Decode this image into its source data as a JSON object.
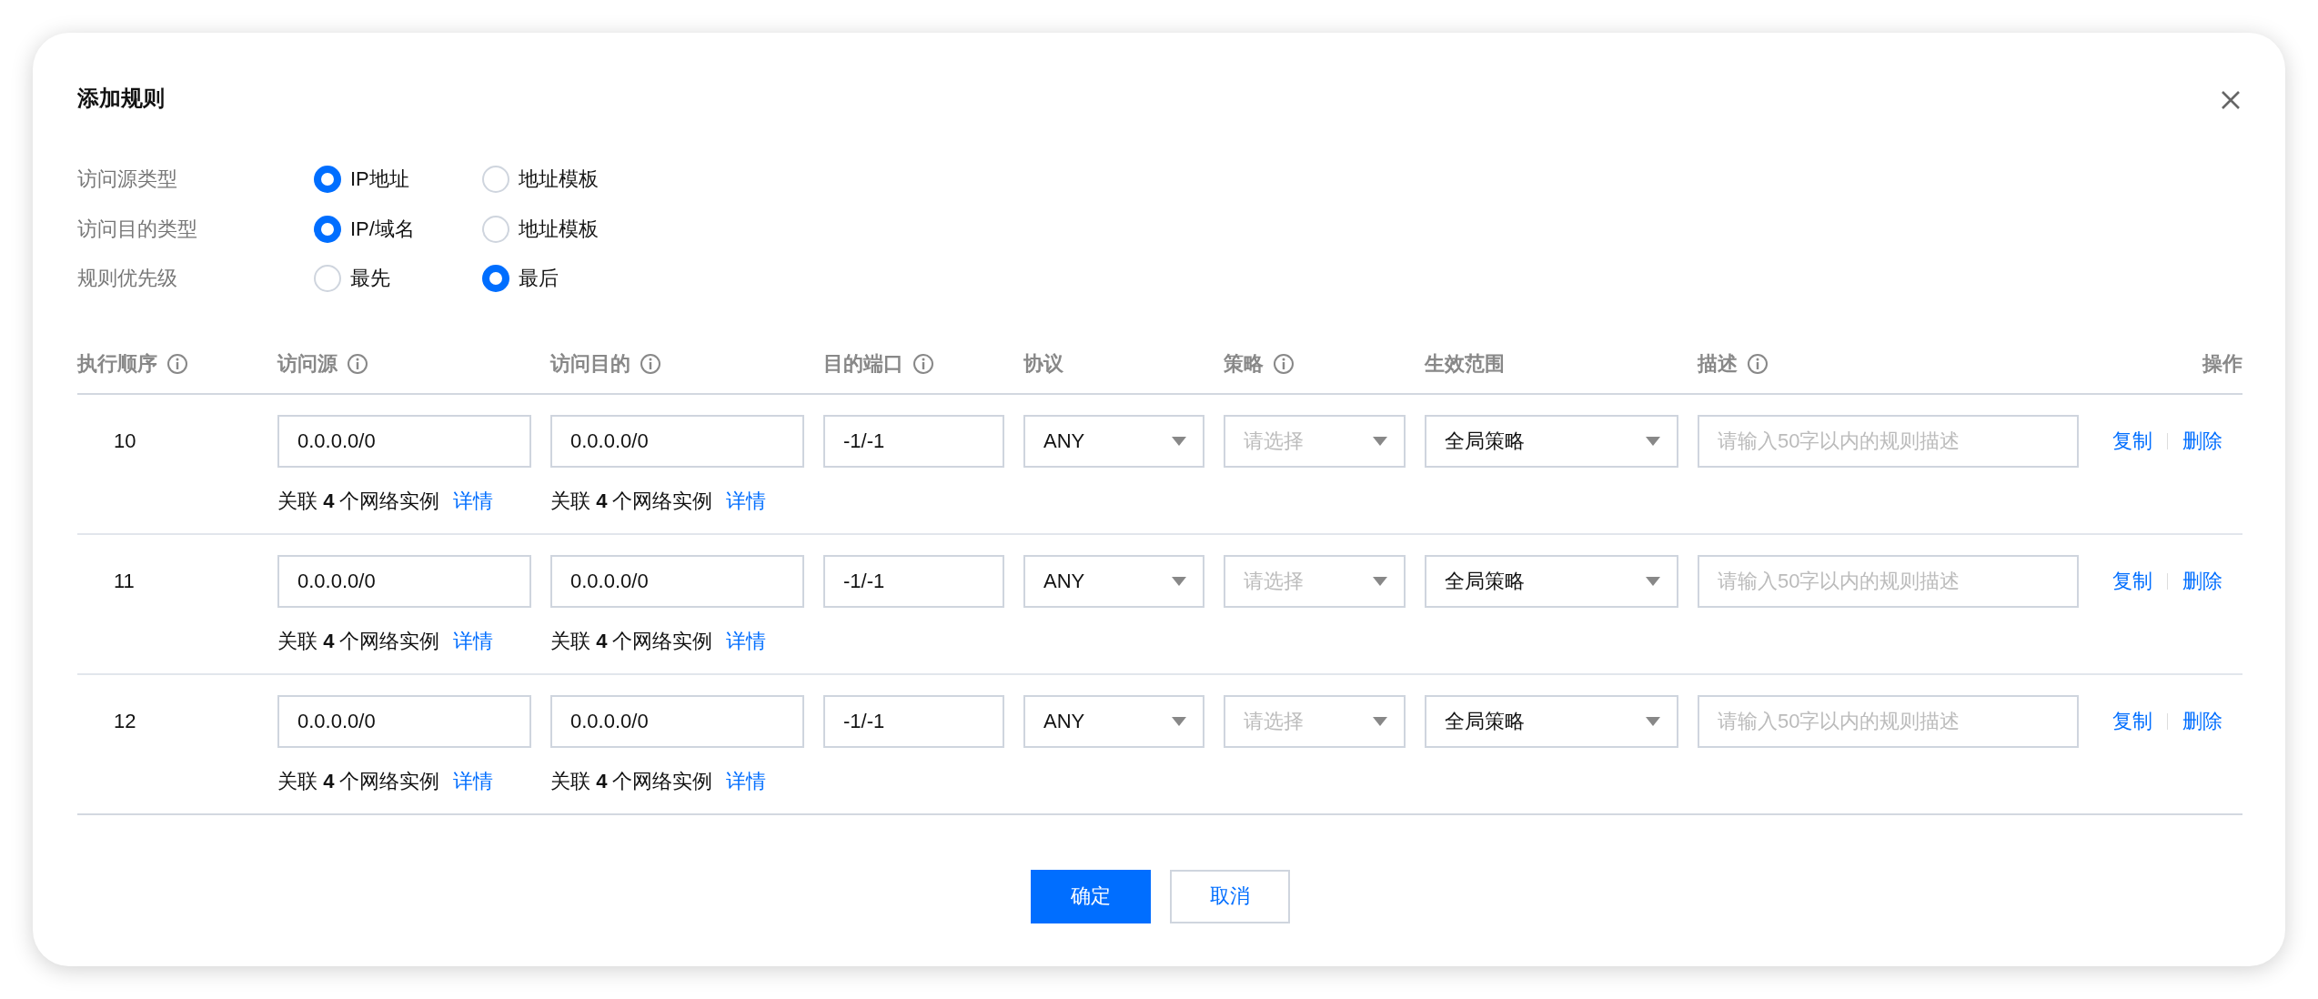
{
  "dialog": {
    "title": "添加规则"
  },
  "settings": [
    {
      "label": "访问源类型",
      "options": [
        {
          "label": "IP地址",
          "selected": true
        },
        {
          "label": "地址模板",
          "selected": false
        }
      ]
    },
    {
      "label": "访问目的类型",
      "options": [
        {
          "label": "IP/域名",
          "selected": true
        },
        {
          "label": "地址模板",
          "selected": false
        }
      ]
    },
    {
      "label": "规则优先级",
      "options": [
        {
          "label": "最先",
          "selected": false
        },
        {
          "label": "最后",
          "selected": true
        }
      ]
    }
  ],
  "table": {
    "columns": [
      {
        "label": "执行顺序",
        "info": true
      },
      {
        "label": "访问源",
        "info": true
      },
      {
        "label": "访问目的",
        "info": true
      },
      {
        "label": "目的端口",
        "info": true
      },
      {
        "label": "协议",
        "info": false
      },
      {
        "label": "策略",
        "info": true
      },
      {
        "label": "生效范围",
        "info": false
      },
      {
        "label": "描述",
        "info": true
      },
      {
        "label": "操作",
        "info": false
      }
    ],
    "rows": [
      {
        "order": "10",
        "source": {
          "value": "0.0.0.0/0",
          "note": "关联 **4** 个网络实例",
          "link": "详情"
        },
        "destination": {
          "value": "0.0.0.0/0",
          "note": "关联 **4** 个网络实例",
          "link": "详情"
        },
        "port": "-1/-1",
        "protocol": "ANY",
        "policy": {
          "placeholder": "请选择"
        },
        "scope": "全局策略",
        "description": {
          "placeholder": "请输入50字以内的规则描述"
        },
        "actions": [
          "复制",
          "删除"
        ]
      },
      {
        "order": "11",
        "source": {
          "value": "0.0.0.0/0",
          "note": "关联 **4** 个网络实例",
          "link": "详情"
        },
        "destination": {
          "value": "0.0.0.0/0",
          "note": "关联 **4** 个网络实例",
          "link": "详情"
        },
        "port": "-1/-1",
        "protocol": "ANY",
        "policy": {
          "placeholder": "请选择"
        },
        "scope": "全局策略",
        "description": {
          "placeholder": "请输入50字以内的规则描述"
        },
        "actions": [
          "复制",
          "删除"
        ]
      },
      {
        "order": "12",
        "source": {
          "value": "0.0.0.0/0",
          "note": "关联 **4** 个网络实例",
          "link": "详情"
        },
        "destination": {
          "value": "0.0.0.0/0",
          "note": "关联 **4** 个网络实例",
          "link": "详情"
        },
        "port": "-1/-1",
        "protocol": "ANY",
        "policy": {
          "placeholder": "请选择"
        },
        "scope": "全局策略",
        "description": {
          "placeholder": "请输入50字以内的规则描述"
        },
        "actions": [
          "复制",
          "删除"
        ]
      }
    ]
  },
  "buttons": [
    {
      "label": "确定",
      "kind": "primary"
    },
    {
      "label": "取消",
      "kind": "secondary"
    }
  ]
}
